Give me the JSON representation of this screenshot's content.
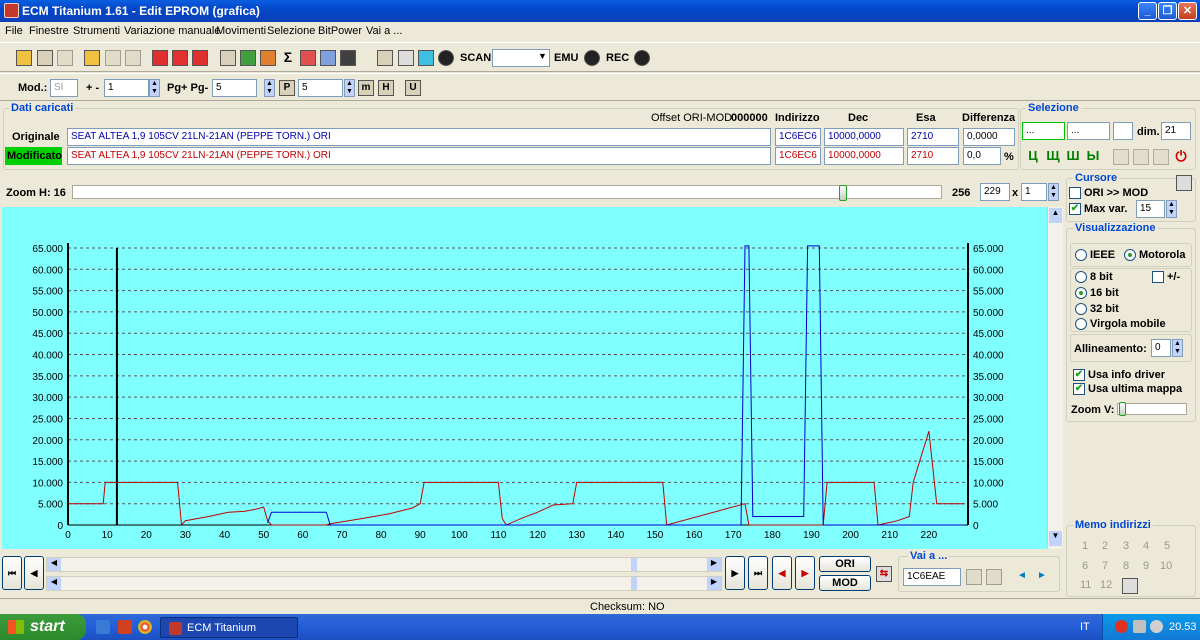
{
  "window": {
    "title": "ECM Titanium 1.61 - Edit EPROM (grafica)"
  },
  "menu": [
    "File",
    "Finestre",
    "Strumenti",
    "Variazione manuale",
    "Movimenti",
    "Selezione",
    "BitPower",
    "Vai a ..."
  ],
  "toolbar1": {
    "scan_label": "SCAN",
    "emu_label": "EMU",
    "rec_label": "REC",
    "sigma": "Σ"
  },
  "toolbar2": {
    "mod_label": "Mod.:",
    "mod_value": "SI",
    "plusminus_label": "+ -",
    "plusminus_value": "1",
    "pg_label": "Pg+ Pg-",
    "pg_value": "5",
    "p_value": "5"
  },
  "dati": {
    "title": "Dati caricati",
    "offset_label": "Offset ORI-MOD",
    "offset_value": "000000",
    "headers": {
      "indirizzo": "Indirizzo",
      "dec": "Dec",
      "esa": "Esa",
      "differenza": "Differenza"
    },
    "originale": {
      "label": "Originale",
      "name": "SEAT ALTEA 1,9 105CV 21LN-21AN (PEPPE TORN.) ORI",
      "indirizzo": "1C6EC6",
      "dec": "10000,0000",
      "esa": "2710",
      "diff": "0,0000"
    },
    "modificato": {
      "label": "Modificato",
      "name": "SEAT ALTEA 1,9 105CV 21LN-21AN (PEPPE TORN.) ORI",
      "indirizzo": "1C6EC6",
      "dec": "10000,0000",
      "esa": "2710",
      "diff": "0,0",
      "pct": "%"
    }
  },
  "selezione": {
    "title": "Selezione",
    "from": "...",
    "to": "...",
    "dim_label": "dim.",
    "dim_value": "21"
  },
  "zoom": {
    "label": "Zoom H: 16",
    "max": "256",
    "value": "229",
    "mult_label": "x",
    "mult_value": "1"
  },
  "cursore": {
    "title": "Cursore",
    "ori_mod_label": "ORI >> MOD",
    "ori_mod_checked": false,
    "maxvar_label": "Max var.",
    "maxvar_checked": true,
    "maxvar_value": "15"
  },
  "visualizzazione": {
    "title": "Visualizzazione",
    "ieee": "IEEE",
    "motorola": "Motorola",
    "selected_endian": "Motorola",
    "bit8": "8 bit",
    "plusminus": "+/-",
    "bit16": "16 bit",
    "bit32": "32 bit",
    "virgola": "Virgola mobile",
    "selected_bits": "16 bit",
    "allineamento_label": "Allineamento:",
    "allineamento_value": "0",
    "usa_info_driver": "Usa info driver",
    "usa_ultima_mappa": "Usa ultima mappa",
    "zoomv_label": "Zoom V:"
  },
  "memo": {
    "title": "Memo indirizzi",
    "items": [
      "1",
      "2",
      "3",
      "4",
      "5",
      "6",
      "7",
      "8",
      "9",
      "10",
      "11",
      "12"
    ]
  },
  "bottom": {
    "ori_label": "ORI",
    "mod_label": "MOD",
    "vai_a_label": "Vai a ...",
    "vai_a_value": "1C6EAE"
  },
  "status": {
    "checksum": "Checksum: NO"
  },
  "taskbar": {
    "start": "start",
    "app_label": "ECM Titanium",
    "lang": "IT",
    "clock": "20.53"
  },
  "colors": {
    "ori_series": "#c00000",
    "mod_series": "#0000cc",
    "chart_bg": "#80ffff",
    "cursor": "#000000"
  },
  "chart_data": {
    "type": "line",
    "xlim": [
      0,
      230
    ],
    "ylim": [
      0,
      65000
    ],
    "x_ticks": [
      0,
      10,
      20,
      30,
      40,
      50,
      60,
      70,
      80,
      90,
      100,
      110,
      120,
      130,
      140,
      150,
      160,
      170,
      180,
      190,
      200,
      210,
      220
    ],
    "y_ticks": [
      0,
      5000,
      10000,
      15000,
      20000,
      25000,
      30000,
      35000,
      40000,
      45000,
      50000,
      55000,
      60000,
      65000
    ],
    "y_tick_labels": [
      "0",
      "5.000",
      "10.000",
      "15.000",
      "20.000",
      "25.000",
      "30.000",
      "35.000",
      "40.000",
      "45.000",
      "50.000",
      "55.000",
      "60.000",
      "65.000"
    ],
    "grid": true,
    "cursor_x": 12.5,
    "series": [
      {
        "color": "#c00000",
        "points": [
          [
            0,
            5000
          ],
          [
            9,
            5000
          ],
          [
            9.5,
            10000
          ],
          [
            28,
            10000
          ],
          [
            29,
            0
          ],
          [
            30,
            1000
          ],
          [
            36,
            2000
          ],
          [
            41,
            3000
          ],
          [
            45,
            3200
          ],
          [
            48,
            3700
          ],
          [
            50,
            4200
          ],
          [
            51,
            1000
          ],
          [
            52,
            0
          ],
          [
            66,
            0
          ],
          [
            67,
            300
          ],
          [
            75,
            1500
          ],
          [
            82,
            2600
          ],
          [
            88,
            4000
          ],
          [
            90,
            5000
          ],
          [
            91,
            10000
          ],
          [
            103,
            10000
          ],
          [
            110,
            10000
          ],
          [
            111,
            1500
          ],
          [
            112,
            0
          ],
          [
            116,
            1600
          ],
          [
            120,
            3000
          ],
          [
            124,
            4700
          ],
          [
            129,
            5000
          ],
          [
            130,
            10000
          ],
          [
            145,
            10000
          ],
          [
            152,
            10000
          ],
          [
            153,
            0
          ],
          [
            173,
            5000
          ],
          [
            174,
            0
          ],
          [
            193,
            0
          ],
          [
            194,
            10000
          ],
          [
            206,
            10000
          ],
          [
            207,
            0
          ],
          [
            212,
            1000
          ],
          [
            215,
            2000
          ],
          [
            216,
            10000
          ],
          [
            220,
            22000
          ],
          [
            222,
            5000
          ],
          [
            229,
            5000
          ]
        ]
      },
      {
        "color": "#0000cc",
        "points": [
          [
            51,
            500
          ],
          [
            52,
            3000
          ],
          [
            62,
            3000
          ],
          [
            66,
            3000
          ],
          [
            67,
            0
          ],
          [
            172,
            0
          ],
          [
            173,
            65500
          ],
          [
            174,
            65500
          ],
          [
            175,
            2000
          ],
          [
            180,
            2000
          ],
          [
            188,
            2000
          ],
          [
            189,
            65500
          ],
          [
            192,
            65500
          ],
          [
            193,
            0
          ],
          [
            229,
            0
          ]
        ]
      }
    ]
  }
}
